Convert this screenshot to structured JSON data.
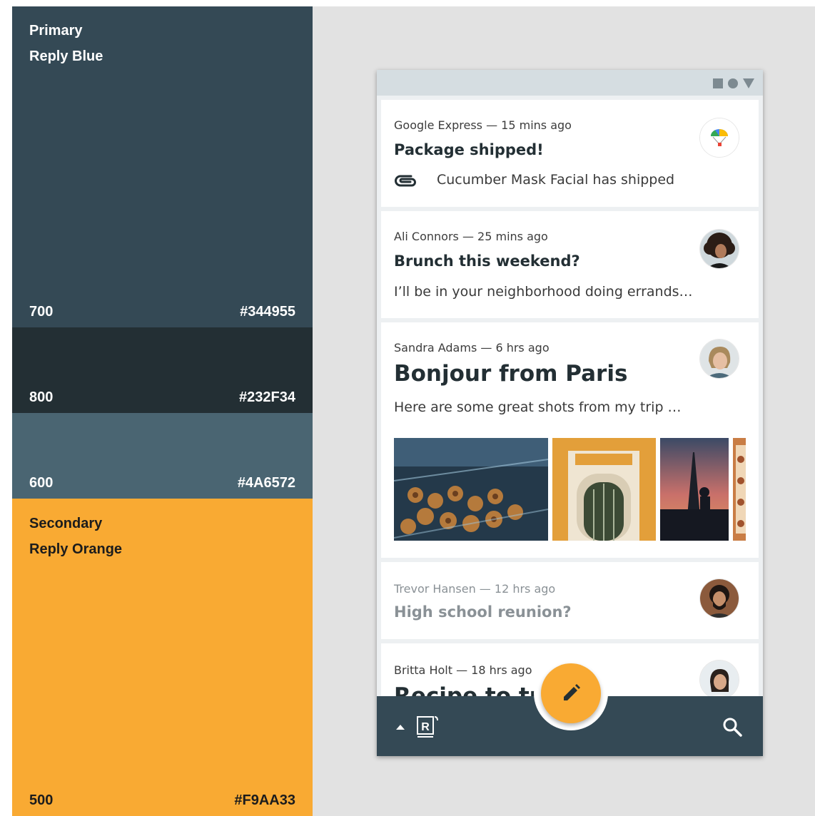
{
  "palette": {
    "primary": {
      "title_line1": "Primary",
      "title_line2": "Reply Blue",
      "swatches": [
        {
          "shade": "700",
          "hex": "#344955"
        },
        {
          "shade": "800",
          "hex": "#232F34"
        },
        {
          "shade": "600",
          "hex": "#4A6572"
        }
      ]
    },
    "secondary": {
      "title_line1": "Secondary",
      "title_line2": "Reply Orange",
      "swatches": [
        {
          "shade": "500",
          "hex": "#F9AA33"
        }
      ]
    }
  },
  "inbox": {
    "emails": [
      {
        "meta": "Google Express — 15 mins ago",
        "subject": "Package shipped!",
        "preview": "Cucumber Mask Facial has shipped",
        "has_attachment": true,
        "avatar_icon": "google-express-logo-icon"
      },
      {
        "meta": "Ali Connors — 25 mins ago",
        "subject": "Brunch this weekend?",
        "preview": "I’ll be in your neighborhood doing errands…",
        "avatar_icon": "ali-connors-avatar"
      },
      {
        "meta": "Sandra Adams — 6 hrs ago",
        "subject": "Bonjour from Paris",
        "preview": "Here are some great shots from my trip …",
        "avatar_icon": "sandra-adams-avatar",
        "photos": [
          "pastries-photo",
          "atelier-door-photo",
          "eiffel-tower-photo",
          "macarons-photo"
        ]
      },
      {
        "meta": "Trevor Hansen — 12 hrs ago",
        "subject": "High school reunion?",
        "avatar_icon": "trevor-hansen-avatar",
        "read": true
      },
      {
        "meta": "Britta Holt — 18 hrs ago",
        "subject": "Recipe to try",
        "avatar_icon": "britta-holt-avatar"
      }
    ]
  },
  "bottom_bar": {
    "logo_letter": "R",
    "icons": [
      "chevron-up-icon",
      "reply-logo-icon",
      "search-icon"
    ],
    "fab_icon": "pencil-icon"
  },
  "colors": {
    "reply_blue_700": "#344955",
    "reply_blue_800": "#232F34",
    "reply_blue_600": "#4A6572",
    "reply_orange_500": "#F9AA33",
    "canvas_bg": "#E2E2E2"
  }
}
